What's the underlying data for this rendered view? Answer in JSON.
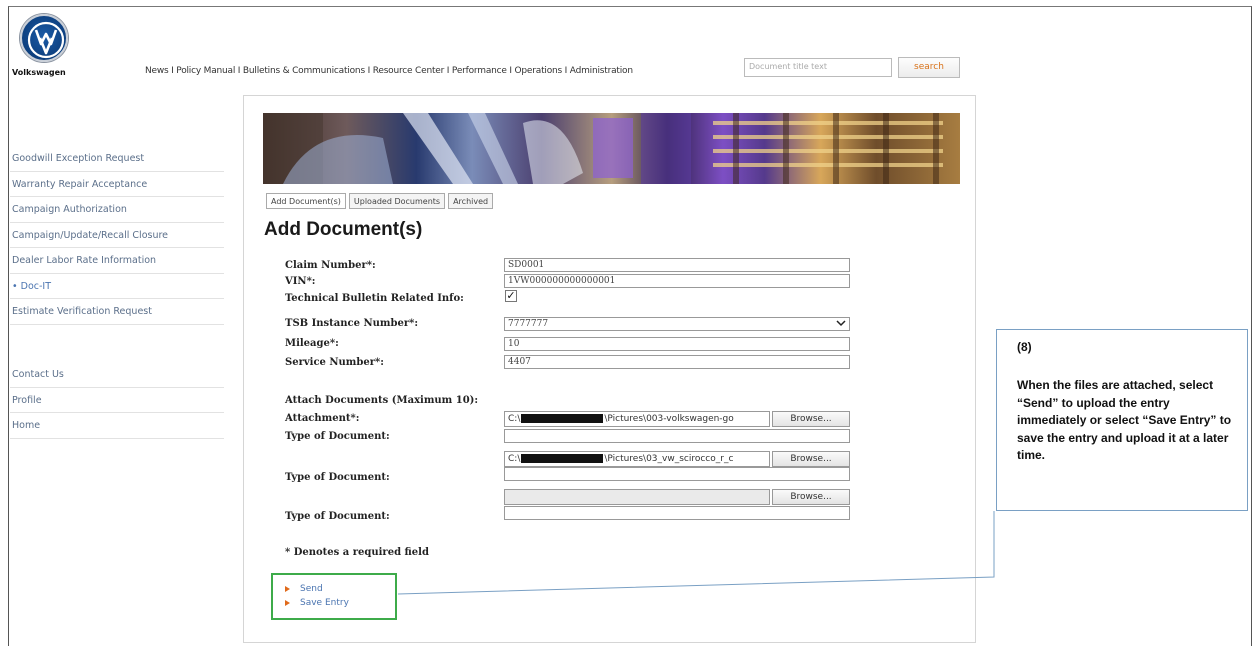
{
  "brand": {
    "name": "Volkswagen",
    "logo": "vw-logo"
  },
  "topnav": {
    "items": [
      "News",
      "Policy Manual",
      "Bulletins & Communications",
      "Resource Center",
      "Performance",
      "Operations",
      "Administration"
    ],
    "text": "News  I  Policy Manual I Bulletins & Communications I Resource Center I Performance I Operations I  Administration"
  },
  "search": {
    "placeholder": "Document title text",
    "button_label": "search"
  },
  "sidebar": {
    "items": [
      {
        "label": "Goodwill Exception Request"
      },
      {
        "label": "Warranty Repair Acceptance"
      },
      {
        "label": "Campaign Authorization"
      },
      {
        "label": "Campaign/Update/Recall Closure"
      },
      {
        "label": "Dealer Labor Rate Information"
      },
      {
        "label": "• Doc-IT"
      },
      {
        "label": "Estimate Verification Request"
      }
    ],
    "secondary": [
      {
        "label": "Contact Us"
      },
      {
        "label": "Profile"
      },
      {
        "label": "Home"
      }
    ]
  },
  "tabs": [
    {
      "label": "Add Document(s)"
    },
    {
      "label": "Uploaded Documents"
    },
    {
      "label": "Archived"
    }
  ],
  "form": {
    "title": "Add Document(s)",
    "claim_label": "Claim Number*:",
    "claim_value": "SD0001",
    "vin_label": "VIN*:",
    "vin_value": "1VW000000000000001",
    "tbri_label": "Technical Bulletin Related Info:",
    "tbri_checked": "✓",
    "tsb_label": "TSB Instance Number*:",
    "tsb_value": "7777777",
    "mileage_label": "Mileage*:",
    "mileage_value": "10",
    "service_label": "Service Number*:",
    "service_value": "4407",
    "attach_heading": "Attach Documents (Maximum 10):",
    "attachment_label": "Attachment*:",
    "type_label": "Type of Document:",
    "file1_prefix": "C:\\",
    "file1_suffix": "\\Pictures\\003-volkswagen-go",
    "file2_prefix": "C:\\",
    "file2_suffix": "\\Pictures\\03_vw_scirocco_r_c",
    "browse_label": "Browse...",
    "required_note": "* Denotes a required field"
  },
  "actions": {
    "send_label": "Send",
    "save_label": "Save Entry"
  },
  "callout": {
    "step": "(8)",
    "text": "When the files are attached, select “Send” to upload the entry immediately or select “Save Entry” to save the entry and upload it at a later time."
  },
  "colors": {
    "link": "#4a74b0",
    "sidebar_text": "#5b6f8a",
    "accent_orange": "#e06a1b",
    "highlight_green": "#3dab4a",
    "callout_border": "#7aa0c4"
  }
}
